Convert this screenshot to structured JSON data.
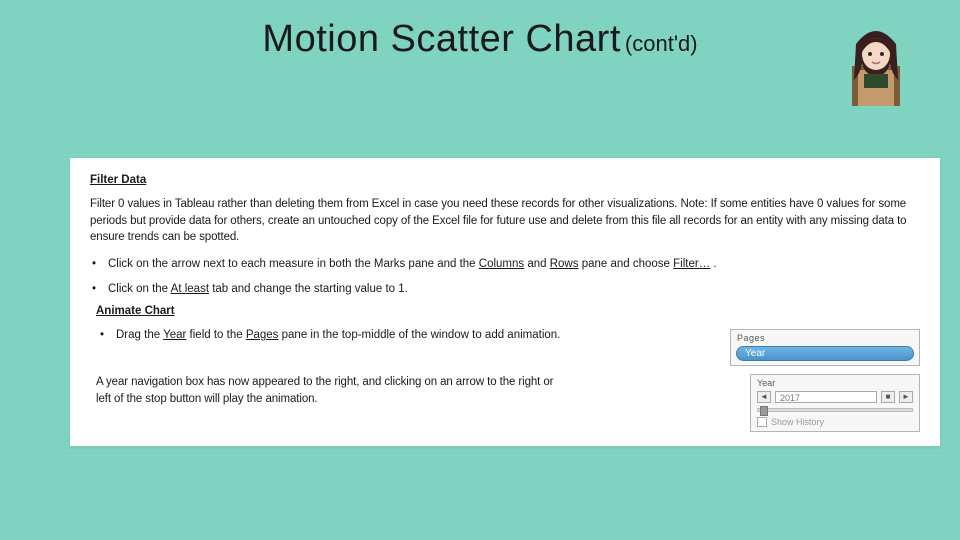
{
  "title": {
    "main": "Motion Scatter Chart",
    "suffix": "(cont'd)"
  },
  "section1": {
    "heading": "Filter Data",
    "para": "Filter 0 values in Tableau rather than deleting them from Excel in case you need these records for other visualizations.  Note: If some entities have 0 values for some periods but provide data for others, create an untouched copy of the Excel file for future use and delete from this file all records for an entity with any missing data to ensure trends can be spotted.",
    "b1_pre": "Click on the arrow next to each measure in both the Marks pane and the ",
    "b1_u1": "Columns",
    "b1_mid": " and ",
    "b1_u2": "Rows",
    "b1_post": " pane and choose ",
    "b1_u3": "Filter…",
    "b1_end": " .",
    "b2_pre": "Click on the ",
    "b2_u1": "At least",
    "b2_post": " tab and change the starting value to 1."
  },
  "section2": {
    "heading": "Animate Chart",
    "b1_pre": "Drag the ",
    "b1_u1": "Year",
    "b1_mid": " field to the ",
    "b1_u2": "Pages",
    "b1_post": " pane in the top-middle of the window to add animation.",
    "note": "A year navigation box has now appeared to the right, and clicking on an arrow to the right or left of the stop button will play the animation."
  },
  "pages_widget": {
    "title": "Pages",
    "pill": "Year"
  },
  "year_widget": {
    "title": "Year",
    "year_value": "2017",
    "prev": "◄",
    "stop": "■",
    "next": "►",
    "show_history": "Show History"
  },
  "bullet": "•"
}
